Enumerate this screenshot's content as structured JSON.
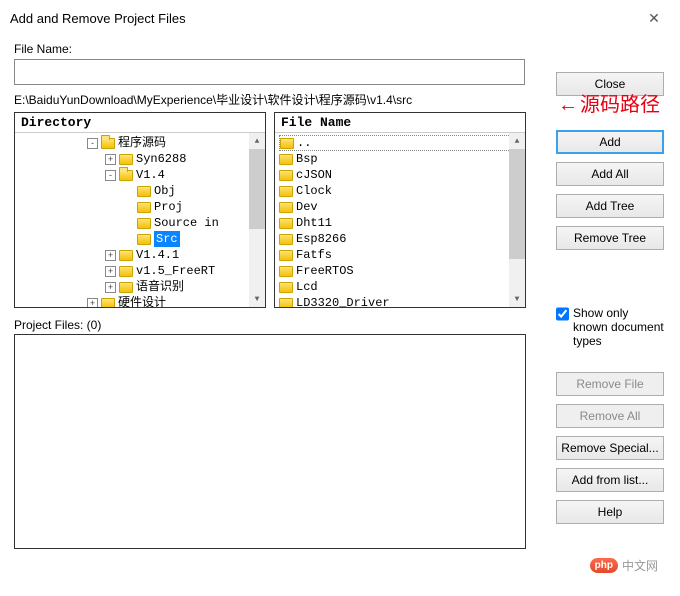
{
  "window": {
    "title": "Add and Remove Project Files",
    "close_glyph": "✕"
  },
  "labels": {
    "file_name": "File Name:",
    "path": "E:\\BaiduYunDownload\\MyExperience\\毕业设计\\软件设计\\程序源码\\v1.4\\src",
    "annotation": "源码路径",
    "directory_header": "Directory",
    "filename_header": "File Name",
    "project_files": "Project Files: (0)",
    "show_only_known": "Show only known document types"
  },
  "input": {
    "file_name_value": ""
  },
  "tree": [
    {
      "depth": 0,
      "exp": "-",
      "open": true,
      "label": "程序源码"
    },
    {
      "depth": 1,
      "exp": "+",
      "open": false,
      "label": "Syn6288"
    },
    {
      "depth": 1,
      "exp": "-",
      "open": true,
      "label": "V1.4"
    },
    {
      "depth": 2,
      "exp": "",
      "open": false,
      "label": "Obj"
    },
    {
      "depth": 2,
      "exp": "",
      "open": false,
      "label": "Proj"
    },
    {
      "depth": 2,
      "exp": "",
      "open": false,
      "label": "Source in"
    },
    {
      "depth": 2,
      "exp": "",
      "open": false,
      "label": "Src",
      "selected": true
    },
    {
      "depth": 1,
      "exp": "+",
      "open": false,
      "label": "V1.4.1"
    },
    {
      "depth": 1,
      "exp": "+",
      "open": false,
      "label": "v1.5_FreeRT"
    },
    {
      "depth": 1,
      "exp": "+",
      "open": false,
      "label": "语音识别"
    },
    {
      "depth": 0,
      "exp": "+",
      "open": false,
      "label": "硬件设计"
    }
  ],
  "files": [
    "..",
    "Bsp",
    "cJSON",
    "Clock",
    "Dev",
    "Dht11",
    "Esp8266",
    "Fatfs",
    "FreeRTOS",
    "Lcd",
    "LD3320_Driver"
  ],
  "buttons": {
    "close": "Close",
    "add": "Add",
    "add_all": "Add All",
    "add_tree": "Add Tree",
    "remove_tree": "Remove Tree",
    "remove_file": "Remove File",
    "remove_all": "Remove All",
    "remove_special": "Remove Special...",
    "add_from_list": "Add from list...",
    "help": "Help"
  },
  "checkbox": {
    "show_only_known_checked": true
  },
  "watermark": {
    "badge": "php",
    "text": "中文网"
  }
}
